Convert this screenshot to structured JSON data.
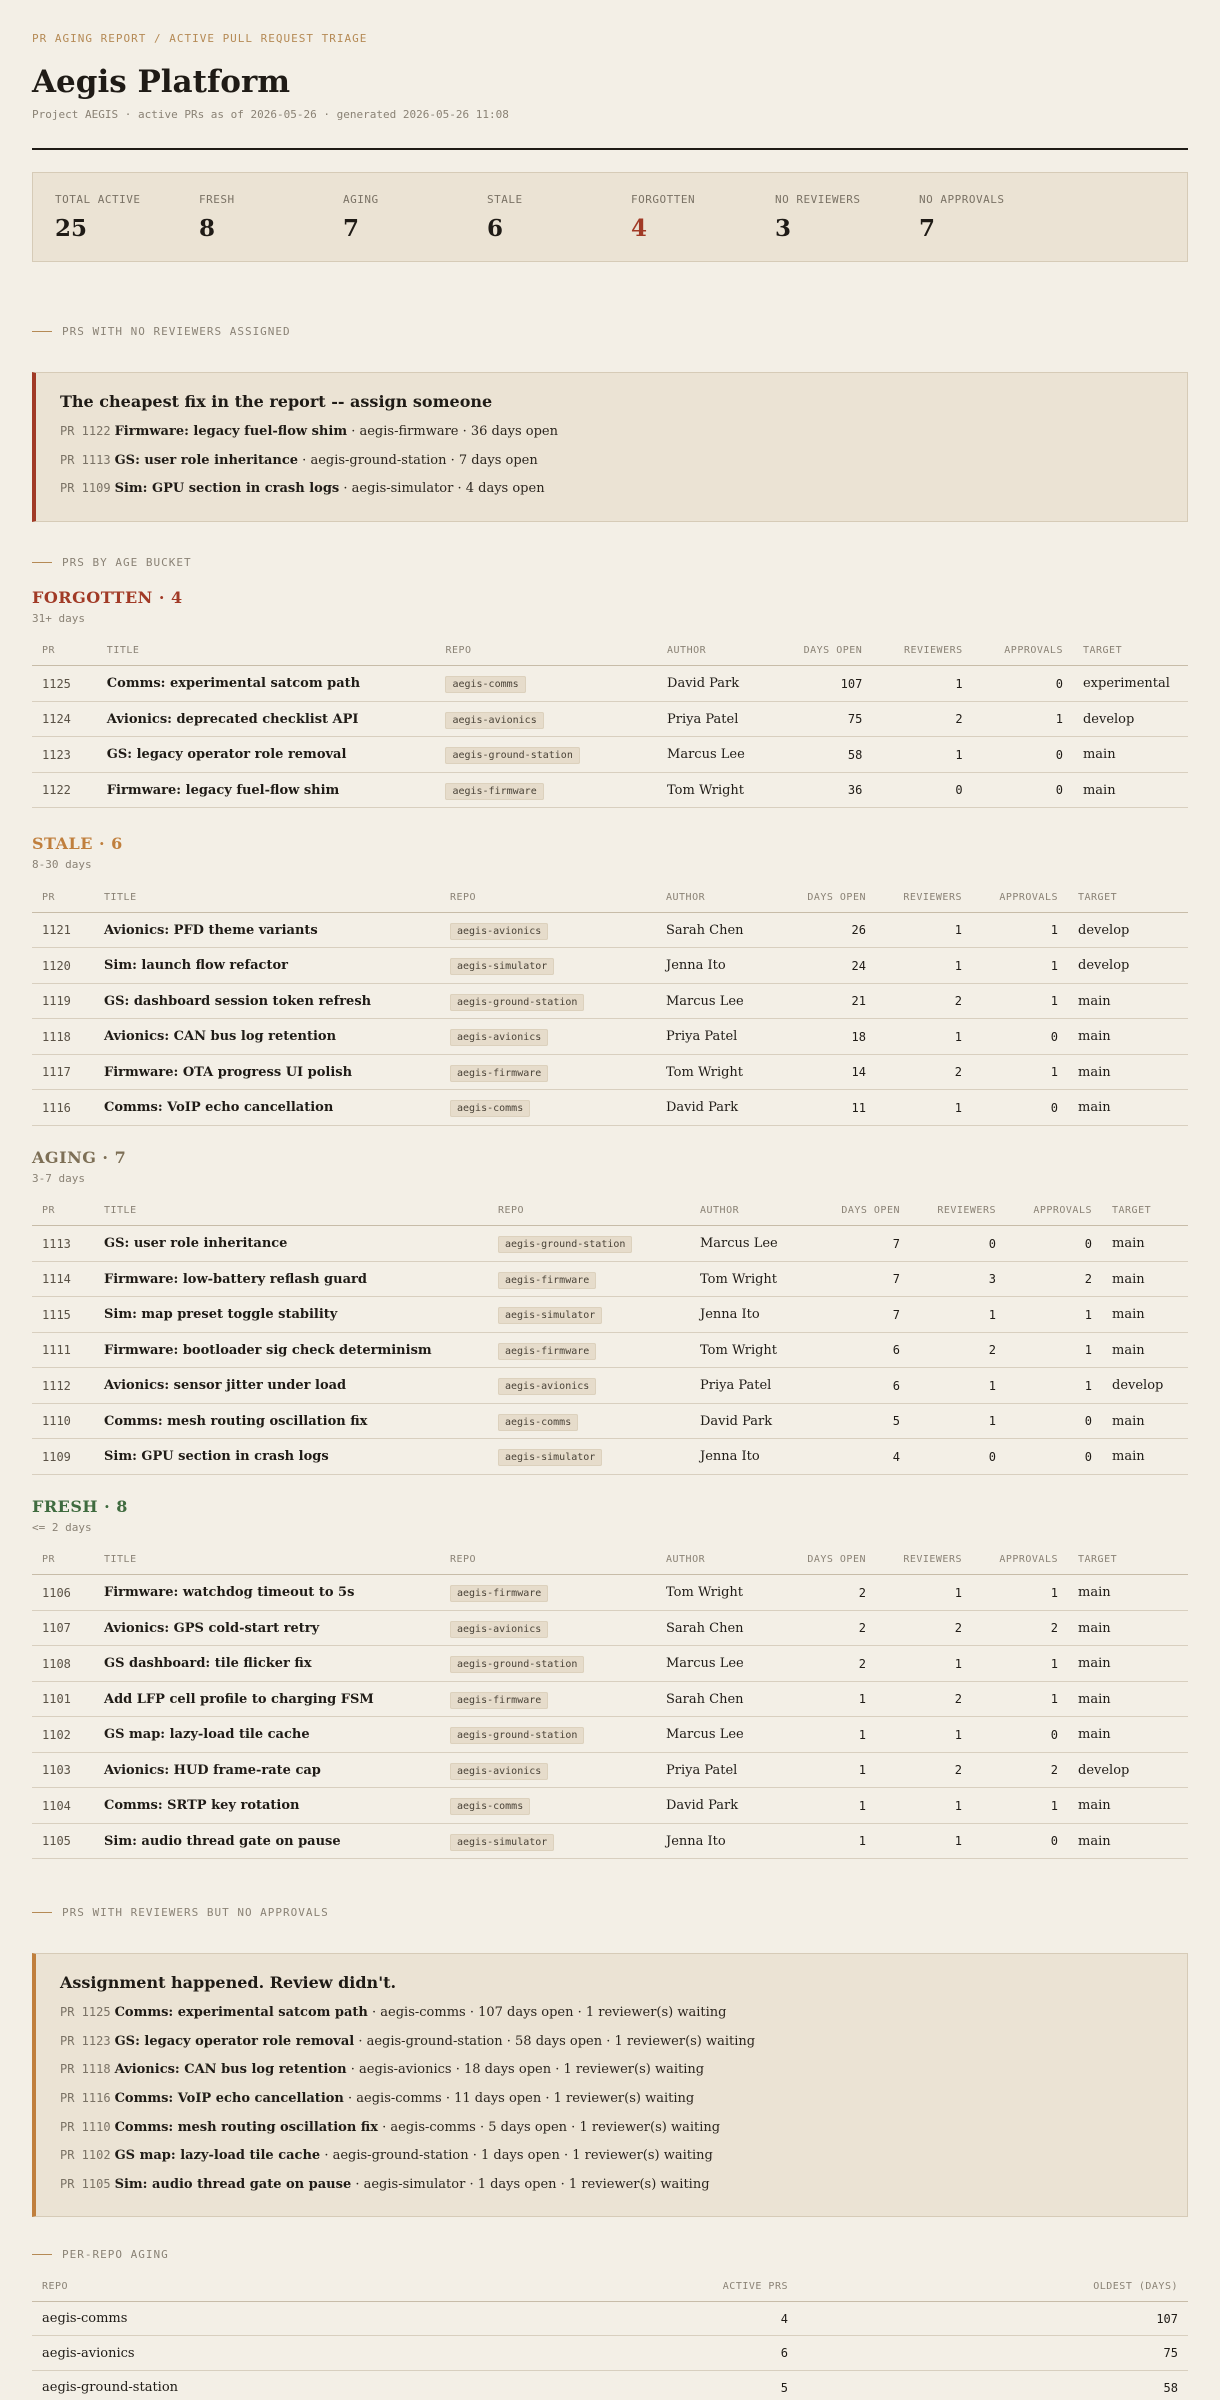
{
  "kicker": "PR AGING REPORT / ACTIVE PULL REQUEST TRIAGE",
  "title": "Aegis Platform",
  "subline": "Project AEGIS · active PRs as of 2026-05-26 · generated 2026-05-26 11:08",
  "stats": [
    {
      "label": "TOTAL ACTIVE",
      "value": "25"
    },
    {
      "label": "FRESH",
      "value": "8"
    },
    {
      "label": "AGING",
      "value": "7"
    },
    {
      "label": "STALE",
      "value": "6"
    },
    {
      "label": "FORGOTTEN",
      "value": "4"
    },
    {
      "label": "NO REVIEWERS",
      "value": "3"
    },
    {
      "label": "NO APPROVALS",
      "value": "7"
    }
  ],
  "colors": {
    "accent_red": "#a13a26",
    "accent_orange": "#c07f3d",
    "aging": "#7d6f56",
    "fresh": "#3f6b3f",
    "stale": "#c07f3d"
  },
  "no_reviewers": {
    "section_label": "PRS WITH NO REVIEWERS ASSIGNED",
    "title": "The cheapest fix in the report -- assign someone",
    "items": [
      {
        "pr": "PR 1122",
        "title": "Firmware: legacy fuel-flow shim",
        "rest": " · aegis-firmware · 36 days open"
      },
      {
        "pr": "PR 1113",
        "title": "GS: user role inheritance",
        "rest": " · aegis-ground-station · 7 days open"
      },
      {
        "pr": "PR 1109",
        "title": "Sim: GPU section in crash logs",
        "rest": " · aegis-simulator · 4 days open"
      }
    ]
  },
  "buckets_section_label": "PRS BY AGE BUCKET",
  "columns": {
    "pr": "PR",
    "title": "TITLE",
    "repo": "REPO",
    "author": "AUTHOR",
    "days": "DAYS OPEN",
    "reviewers": "REVIEWERS",
    "approvals": "APPROVALS",
    "target": "TARGET"
  },
  "buckets": [
    {
      "title": "FORGOTTEN · 4",
      "sub": "31+ days",
      "rows": [
        {
          "pr": "1125",
          "title": "Comms: experimental satcom path",
          "repo": "aegis-comms",
          "author": "David Park",
          "days": "107",
          "reviewers": "1",
          "approvals": "0",
          "target": "experimental"
        },
        {
          "pr": "1124",
          "title": "Avionics: deprecated checklist API",
          "repo": "aegis-avionics",
          "author": "Priya Patel",
          "days": "75",
          "reviewers": "2",
          "approvals": "1",
          "target": "develop"
        },
        {
          "pr": "1123",
          "title": "GS: legacy operator role removal",
          "repo": "aegis-ground-station",
          "author": "Marcus Lee",
          "days": "58",
          "reviewers": "1",
          "approvals": "0",
          "target": "main"
        },
        {
          "pr": "1122",
          "title": "Firmware: legacy fuel-flow shim",
          "repo": "aegis-firmware",
          "author": "Tom Wright",
          "days": "36",
          "reviewers": "0",
          "approvals": "0",
          "target": "main"
        }
      ]
    },
    {
      "title": "STALE · 6",
      "sub": "8-30 days",
      "rows": [
        {
          "pr": "1121",
          "title": "Avionics: PFD theme variants",
          "repo": "aegis-avionics",
          "author": "Sarah Chen",
          "days": "26",
          "reviewers": "1",
          "approvals": "1",
          "target": "develop"
        },
        {
          "pr": "1120",
          "title": "Sim: launch flow refactor",
          "repo": "aegis-simulator",
          "author": "Jenna Ito",
          "days": "24",
          "reviewers": "1",
          "approvals": "1",
          "target": "develop"
        },
        {
          "pr": "1119",
          "title": "GS: dashboard session token refresh",
          "repo": "aegis-ground-station",
          "author": "Marcus Lee",
          "days": "21",
          "reviewers": "2",
          "approvals": "1",
          "target": "main"
        },
        {
          "pr": "1118",
          "title": "Avionics: CAN bus log retention",
          "repo": "aegis-avionics",
          "author": "Priya Patel",
          "days": "18",
          "reviewers": "1",
          "approvals": "0",
          "target": "main"
        },
        {
          "pr": "1117",
          "title": "Firmware: OTA progress UI polish",
          "repo": "aegis-firmware",
          "author": "Tom Wright",
          "days": "14",
          "reviewers": "2",
          "approvals": "1",
          "target": "main"
        },
        {
          "pr": "1116",
          "title": "Comms: VoIP echo cancellation",
          "repo": "aegis-comms",
          "author": "David Park",
          "days": "11",
          "reviewers": "1",
          "approvals": "0",
          "target": "main"
        }
      ]
    },
    {
      "title": "AGING · 7",
      "sub": "3-7 days",
      "rows": [
        {
          "pr": "1113",
          "title": "GS: user role inheritance",
          "repo": "aegis-ground-station",
          "author": "Marcus Lee",
          "days": "7",
          "reviewers": "0",
          "approvals": "0",
          "target": "main"
        },
        {
          "pr": "1114",
          "title": "Firmware: low-battery reflash guard",
          "repo": "aegis-firmware",
          "author": "Tom Wright",
          "days": "7",
          "reviewers": "3",
          "approvals": "2",
          "target": "main"
        },
        {
          "pr": "1115",
          "title": "Sim: map preset toggle stability",
          "repo": "aegis-simulator",
          "author": "Jenna Ito",
          "days": "7",
          "reviewers": "1",
          "approvals": "1",
          "target": "main"
        },
        {
          "pr": "1111",
          "title": "Firmware: bootloader sig check determinism",
          "repo": "aegis-firmware",
          "author": "Tom Wright",
          "days": "6",
          "reviewers": "2",
          "approvals": "1",
          "target": "main"
        },
        {
          "pr": "1112",
          "title": "Avionics: sensor jitter under load",
          "repo": "aegis-avionics",
          "author": "Priya Patel",
          "days": "6",
          "reviewers": "1",
          "approvals": "1",
          "target": "develop"
        },
        {
          "pr": "1110",
          "title": "Comms: mesh routing oscillation fix",
          "repo": "aegis-comms",
          "author": "David Park",
          "days": "5",
          "reviewers": "1",
          "approvals": "0",
          "target": "main"
        },
        {
          "pr": "1109",
          "title": "Sim: GPU section in crash logs",
          "repo": "aegis-simulator",
          "author": "Jenna Ito",
          "days": "4",
          "reviewers": "0",
          "approvals": "0",
          "target": "main"
        }
      ]
    },
    {
      "title": "FRESH · 8",
      "sub": "<= 2 days",
      "rows": [
        {
          "pr": "1106",
          "title": "Firmware: watchdog timeout to 5s",
          "repo": "aegis-firmware",
          "author": "Tom Wright",
          "days": "2",
          "reviewers": "1",
          "approvals": "1",
          "target": "main"
        },
        {
          "pr": "1107",
          "title": "Avionics: GPS cold-start retry",
          "repo": "aegis-avionics",
          "author": "Sarah Chen",
          "days": "2",
          "reviewers": "2",
          "approvals": "2",
          "target": "main"
        },
        {
          "pr": "1108",
          "title": "GS dashboard: tile flicker fix",
          "repo": "aegis-ground-station",
          "author": "Marcus Lee",
          "days": "2",
          "reviewers": "1",
          "approvals": "1",
          "target": "main"
        },
        {
          "pr": "1101",
          "title": "Add LFP cell profile to charging FSM",
          "repo": "aegis-firmware",
          "author": "Sarah Chen",
          "days": "1",
          "reviewers": "2",
          "approvals": "1",
          "target": "main"
        },
        {
          "pr": "1102",
          "title": "GS map: lazy-load tile cache",
          "repo": "aegis-ground-station",
          "author": "Marcus Lee",
          "days": "1",
          "reviewers": "1",
          "approvals": "0",
          "target": "main"
        },
        {
          "pr": "1103",
          "title": "Avionics: HUD frame-rate cap",
          "repo": "aegis-avionics",
          "author": "Priya Patel",
          "days": "1",
          "reviewers": "2",
          "approvals": "2",
          "target": "develop"
        },
        {
          "pr": "1104",
          "title": "Comms: SRTP key rotation",
          "repo": "aegis-comms",
          "author": "David Park",
          "days": "1",
          "reviewers": "1",
          "approvals": "1",
          "target": "main"
        },
        {
          "pr": "1105",
          "title": "Sim: audio thread gate on pause",
          "repo": "aegis-simulator",
          "author": "Jenna Ito",
          "days": "1",
          "reviewers": "1",
          "approvals": "0",
          "target": "main"
        }
      ]
    }
  ],
  "no_approvals": {
    "section_label": "PRS WITH REVIEWERS BUT NO APPROVALS",
    "title": "Assignment happened. Review didn't.",
    "items": [
      {
        "pr": "PR 1125",
        "title": "Comms: experimental satcom path",
        "rest": " · aegis-comms · 107 days open · 1 reviewer(s) waiting"
      },
      {
        "pr": "PR 1123",
        "title": "GS: legacy operator role removal",
        "rest": " · aegis-ground-station · 58 days open · 1 reviewer(s) waiting"
      },
      {
        "pr": "PR 1118",
        "title": "Avionics: CAN bus log retention",
        "rest": " · aegis-avionics · 18 days open · 1 reviewer(s) waiting"
      },
      {
        "pr": "PR 1116",
        "title": "Comms: VoIP echo cancellation",
        "rest": " · aegis-comms · 11 days open · 1 reviewer(s) waiting"
      },
      {
        "pr": "PR 1110",
        "title": "Comms: mesh routing oscillation fix",
        "rest": " · aegis-comms · 5 days open · 1 reviewer(s) waiting"
      },
      {
        "pr": "PR 1102",
        "title": "GS map: lazy-load tile cache",
        "rest": " · aegis-ground-station · 1 days open · 1 reviewer(s) waiting"
      },
      {
        "pr": "PR 1105",
        "title": "Sim: audio thread gate on pause",
        "rest": " · aegis-simulator · 1 days open · 1 reviewer(s) waiting"
      }
    ]
  },
  "per_repo": {
    "section_label": "PER-REPO AGING",
    "columns": {
      "repo": "REPO",
      "active": "ACTIVE PRS",
      "oldest": "OLDEST (DAYS)"
    },
    "rows": [
      {
        "repo": "aegis-comms",
        "active": "4",
        "oldest": "107"
      },
      {
        "repo": "aegis-avionics",
        "active": "6",
        "oldest": "75"
      },
      {
        "repo": "aegis-ground-station",
        "active": "5",
        "oldest": "58"
      }
    ]
  }
}
